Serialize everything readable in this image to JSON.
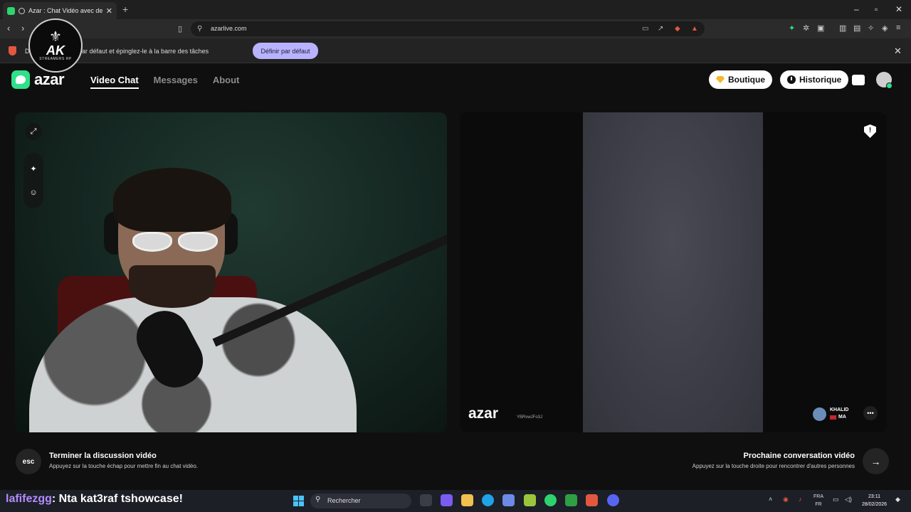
{
  "browser": {
    "tab_title": "Azar : Chat Vidéo avec de no",
    "url": "azarlive.com",
    "infobar_text": "D…me navigateur par défaut et épinglez-le à la barre des tâches",
    "infobar_button": "Définir par défaut",
    "new_tab_symbol": "+",
    "close_symbol": "✕"
  },
  "overlay_badge": {
    "initials": "AK",
    "subtitle": "STREAMERS RP"
  },
  "site": {
    "logo_text": "azar",
    "nav": [
      {
        "label": "Video Chat",
        "active": true
      },
      {
        "label": "Messages",
        "active": false
      },
      {
        "label": "About",
        "active": false
      }
    ],
    "boutique_label": "Boutique",
    "historique_label": "Historique"
  },
  "remote": {
    "watermark": "azar",
    "watermark_id": "YBRvwJFo3J",
    "peer_name": "KHALID",
    "peer_country": "MA"
  },
  "hints": {
    "esc_key": "esc",
    "end_title": "Terminer la discussion vidéo",
    "end_sub": "Appuyez sur la touche échap pour mettre fin au chat vidéo.",
    "next_title": "Prochaine conversation vidéo",
    "next_sub": "Appuyez sur la touche droite pour rencontrer d'autres personnes",
    "next_arrow": "→"
  },
  "stream_chat": {
    "username": "lafifezgg",
    "message": ": Nta kat3raf tshowcase!"
  },
  "taskbar": {
    "search_label": "Rechercher",
    "lang_top": "FRA",
    "lang_bottom": "FR",
    "time": "23:11",
    "date": "28/02/2026"
  },
  "colors": {
    "accent_green": "#2fe08a",
    "infobar_button_bg": "#b9b3ff",
    "boutique_icon": "#f6b72d",
    "chat_username": "#b48cff"
  }
}
